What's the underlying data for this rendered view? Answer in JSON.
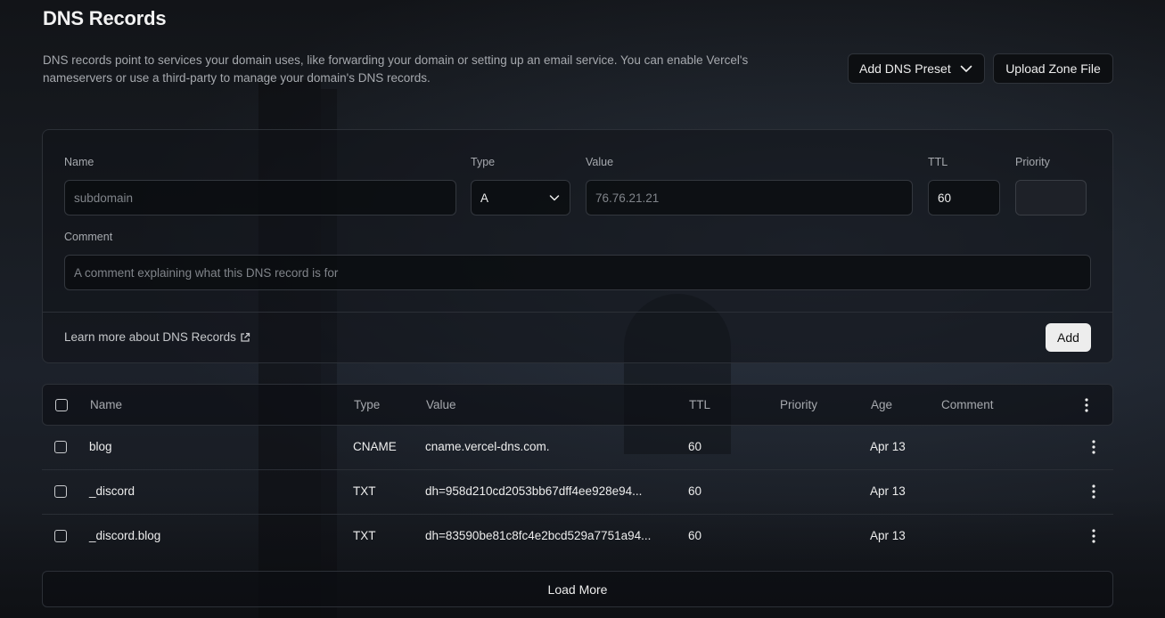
{
  "page": {
    "title": "DNS Records",
    "description": "DNS records point to services your domain uses, like forwarding your domain or setting up an email service. You can enable Vercel's nameservers or use a third-party to manage your domain's DNS records."
  },
  "actions": {
    "preset_label": "Add DNS Preset",
    "upload_label": "Upload Zone File"
  },
  "form": {
    "name_label": "Name",
    "name_placeholder": "subdomain",
    "type_label": "Type",
    "type_value": "A",
    "value_label": "Value",
    "value_placeholder": "76.76.21.21",
    "ttl_label": "TTL",
    "ttl_value": "60",
    "priority_label": "Priority",
    "comment_label": "Comment",
    "comment_placeholder": "A comment explaining what this DNS record is for",
    "learn_more": "Learn more about DNS Records",
    "add_label": "Add"
  },
  "table": {
    "headers": {
      "name": "Name",
      "type": "Type",
      "value": "Value",
      "ttl": "TTL",
      "priority": "Priority",
      "age": "Age",
      "comment": "Comment"
    },
    "rows": [
      {
        "name": "blog",
        "type": "CNAME",
        "value": "cname.vercel-dns.com.",
        "ttl": "60",
        "priority": "",
        "age": "Apr 13",
        "comment": ""
      },
      {
        "name": "_discord",
        "type": "TXT",
        "value": "dh=958d210cd2053bb67dff4ee928e94...",
        "ttl": "60",
        "priority": "",
        "age": "Apr 13",
        "comment": ""
      },
      {
        "name": "_discord.blog",
        "type": "TXT",
        "value": "dh=83590be81c8fc4e2bcd529a7751a94...",
        "ttl": "60",
        "priority": "",
        "age": "Apr 13",
        "comment": ""
      }
    ],
    "load_more": "Load More"
  }
}
